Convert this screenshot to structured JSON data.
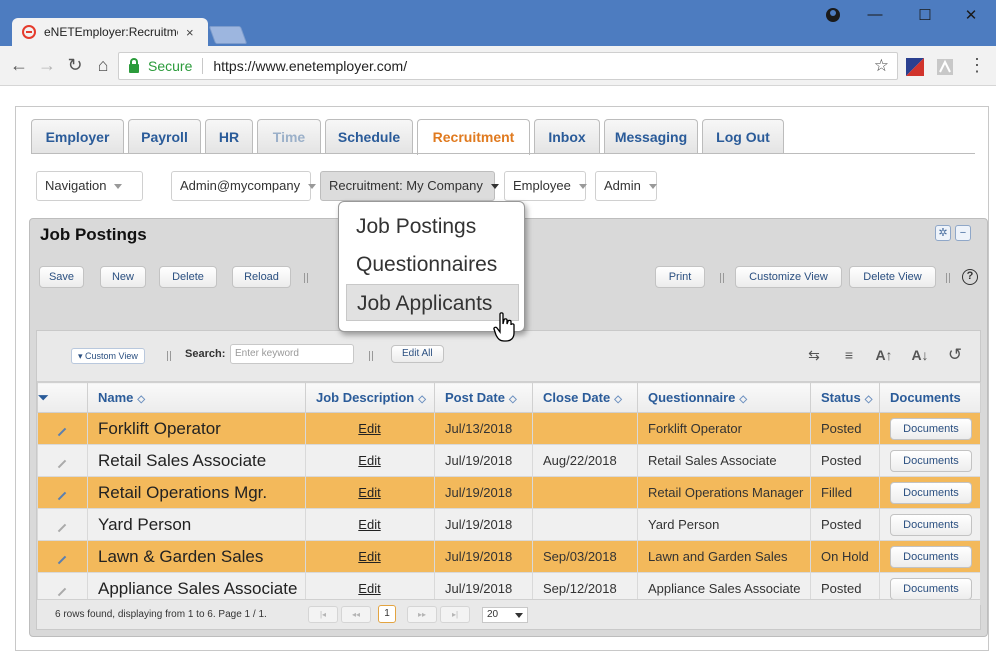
{
  "browser": {
    "tab_title": "eNETEmployer:Recruitme",
    "tab_close": "×",
    "secure_label": "Secure",
    "url": "https://www.enetemployer.com/",
    "window_controls": [
      "—",
      "☐",
      "✕"
    ]
  },
  "tabs": [
    {
      "label": "Employer",
      "state": "normal"
    },
    {
      "label": "Payroll",
      "state": "normal"
    },
    {
      "label": "HR",
      "state": "normal"
    },
    {
      "label": "Time",
      "state": "disabled"
    },
    {
      "label": "Schedule",
      "state": "normal"
    },
    {
      "label": "Recruitment",
      "state": "active"
    },
    {
      "label": "Inbox",
      "state": "normal"
    },
    {
      "label": "Messaging",
      "state": "normal"
    },
    {
      "label": "Log Out",
      "state": "normal"
    }
  ],
  "selectors": {
    "navigation": "Navigation",
    "account": "Admin@mycompany",
    "section": "Recruitment: My Company",
    "employee": "Employee",
    "admin": "Admin"
  },
  "menu": {
    "items": [
      "Job Postings",
      "Questionnaires",
      "Job Applicants"
    ],
    "hovered": "Job Applicants"
  },
  "panel": {
    "title": "Job Postings",
    "buttons_left": [
      "Save",
      "New",
      "Delete",
      "Reload"
    ],
    "buttons_right": [
      "Print",
      "Customize View",
      "Delete View"
    ],
    "help": "?"
  },
  "grid_toolbar": {
    "custom_view": "Custom View",
    "search_label": "Search:",
    "search_placeholder": "Enter keyword",
    "edit_all": "Edit All"
  },
  "columns": [
    "Name",
    "Job Description",
    "Post Date",
    "Close Date",
    "Questionnaire",
    "Status",
    "Documents"
  ],
  "rows": [
    {
      "name": "Forklift Operator",
      "desc": "Edit",
      "post": "Jul/13/2018",
      "close": "",
      "quest": "Forklift Operator",
      "status": "Posted",
      "docs": "Documents",
      "highlight": true
    },
    {
      "name": "Retail Sales Associate",
      "desc": "Edit",
      "post": "Jul/19/2018",
      "close": "Aug/22/2018",
      "quest": "Retail Sales Associate",
      "status": "Posted",
      "docs": "Documents",
      "highlight": false
    },
    {
      "name": "Retail Operations Mgr.",
      "desc": "Edit",
      "post": "Jul/19/2018",
      "close": "",
      "quest": "Retail Operations Manager",
      "status": "Filled",
      "docs": "Documents",
      "highlight": true
    },
    {
      "name": "Yard Person",
      "desc": "Edit",
      "post": "Jul/19/2018",
      "close": "",
      "quest": "Yard Person",
      "status": "Posted",
      "docs": "Documents",
      "highlight": false
    },
    {
      "name": "Lawn & Garden Sales",
      "desc": "Edit",
      "post": "Jul/19/2018",
      "close": "Sep/03/2018",
      "quest": "Lawn and Garden Sales",
      "status": "On Hold",
      "docs": "Documents",
      "highlight": true
    },
    {
      "name": "Appliance Sales Associate",
      "desc": "Edit",
      "post": "Jul/19/2018",
      "close": "Sep/12/2018",
      "quest": "Appliance Sales Associate",
      "status": "Posted",
      "docs": "Documents",
      "highlight": false
    }
  ],
  "pager": {
    "summary": "6 rows found, displaying from 1 to 6. Page 1 / 1.",
    "current_page": "1",
    "page_size": "20"
  },
  "colors": {
    "highlight_row": "#f3b95b",
    "active_tab": "#e07a1f",
    "link_blue": "#2a5b99"
  }
}
